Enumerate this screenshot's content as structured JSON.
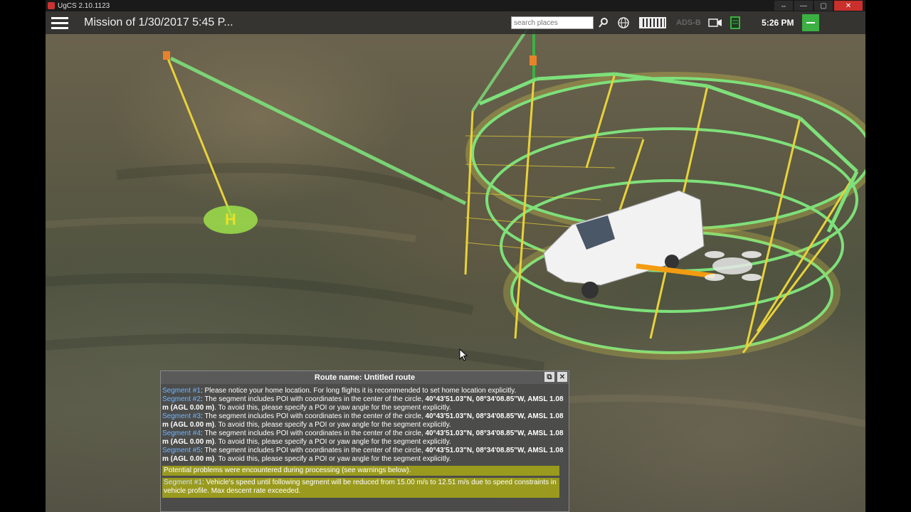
{
  "window": {
    "title": "UgCS 2.10.1123",
    "controls": [
      "⇔",
      "—",
      "▢",
      "✕"
    ]
  },
  "app_bar": {
    "mission_title": "Mission of 1/30/2017 5:45 P...",
    "search_placeholder": "search places",
    "adsb_label": "ADS-B",
    "clock": "5:26 PM"
  },
  "icons": {
    "menu": "hamburger-icon",
    "search": "magnifier-icon",
    "globe": "globe-icon",
    "keyboard": "keyboard-icon",
    "camera": "video-camera-icon",
    "telemetry": "device-icon",
    "collapse": "minus-icon"
  },
  "viewport": {
    "home_marker_label": "H"
  },
  "route_panel": {
    "title": "Route name: Untitled route",
    "segments": [
      {
        "label": "Segment #1",
        "text": ": Please notice your home location. For long flights it is recommended to set home location explicitly."
      },
      {
        "label": "Segment #2",
        "text": ": The segment includes POI with coordinates in the center of the circle, ",
        "coords": "40°43'51.03\"N, 08°34'08.85\"W, AMSL 1.08 m (AGL 0.00 m)",
        "tail": ". To avoid this, please specify a POI or yaw angle for the segment explicitly."
      },
      {
        "label": "Segment #3",
        "text": ": The segment includes POI with coordinates in the center of the circle, ",
        "coords": "40°43'51.03\"N, 08°34'08.85\"W, AMSL 1.08 m (AGL 0.00 m)",
        "tail": ". To avoid this, please specify a POI or yaw angle for the segment explicitly."
      },
      {
        "label": "Segment #4",
        "text": ": The segment includes POI with coordinates in the center of the circle, ",
        "coords": "40°43'51.03\"N, 08°34'08.85\"W, AMSL 1.08 m (AGL 0.00 m)",
        "tail": ". To avoid this, please specify a POI or yaw angle for the segment explicitly."
      },
      {
        "label": "Segment #5",
        "text": ": The segment includes POI with coordinates in the center of the circle, ",
        "coords": "40°43'51.03\"N, 08°34'08.85\"W, AMSL 1.08 m (AGL 0.00 m)",
        "tail": ". To avoid this, please specify a POI or yaw angle for the segment explicitly."
      }
    ],
    "warning_banner": "Potential problems were encountered during processing (see warnings below).",
    "warning_detail": {
      "label": "Segment #1",
      "text": ": Vehicle's speed until following segment will be reduced from 15.00 m/s to 12.51 m/s due to speed constraints in vehicle profile. Max descent rate exceeded."
    }
  },
  "colors": {
    "route_green": "#7ee07a",
    "pole_yellow": "#e8d23a",
    "warning_bg": "#9a9a1e",
    "link_blue": "#6fb6ff",
    "close_red": "#c9302c"
  }
}
